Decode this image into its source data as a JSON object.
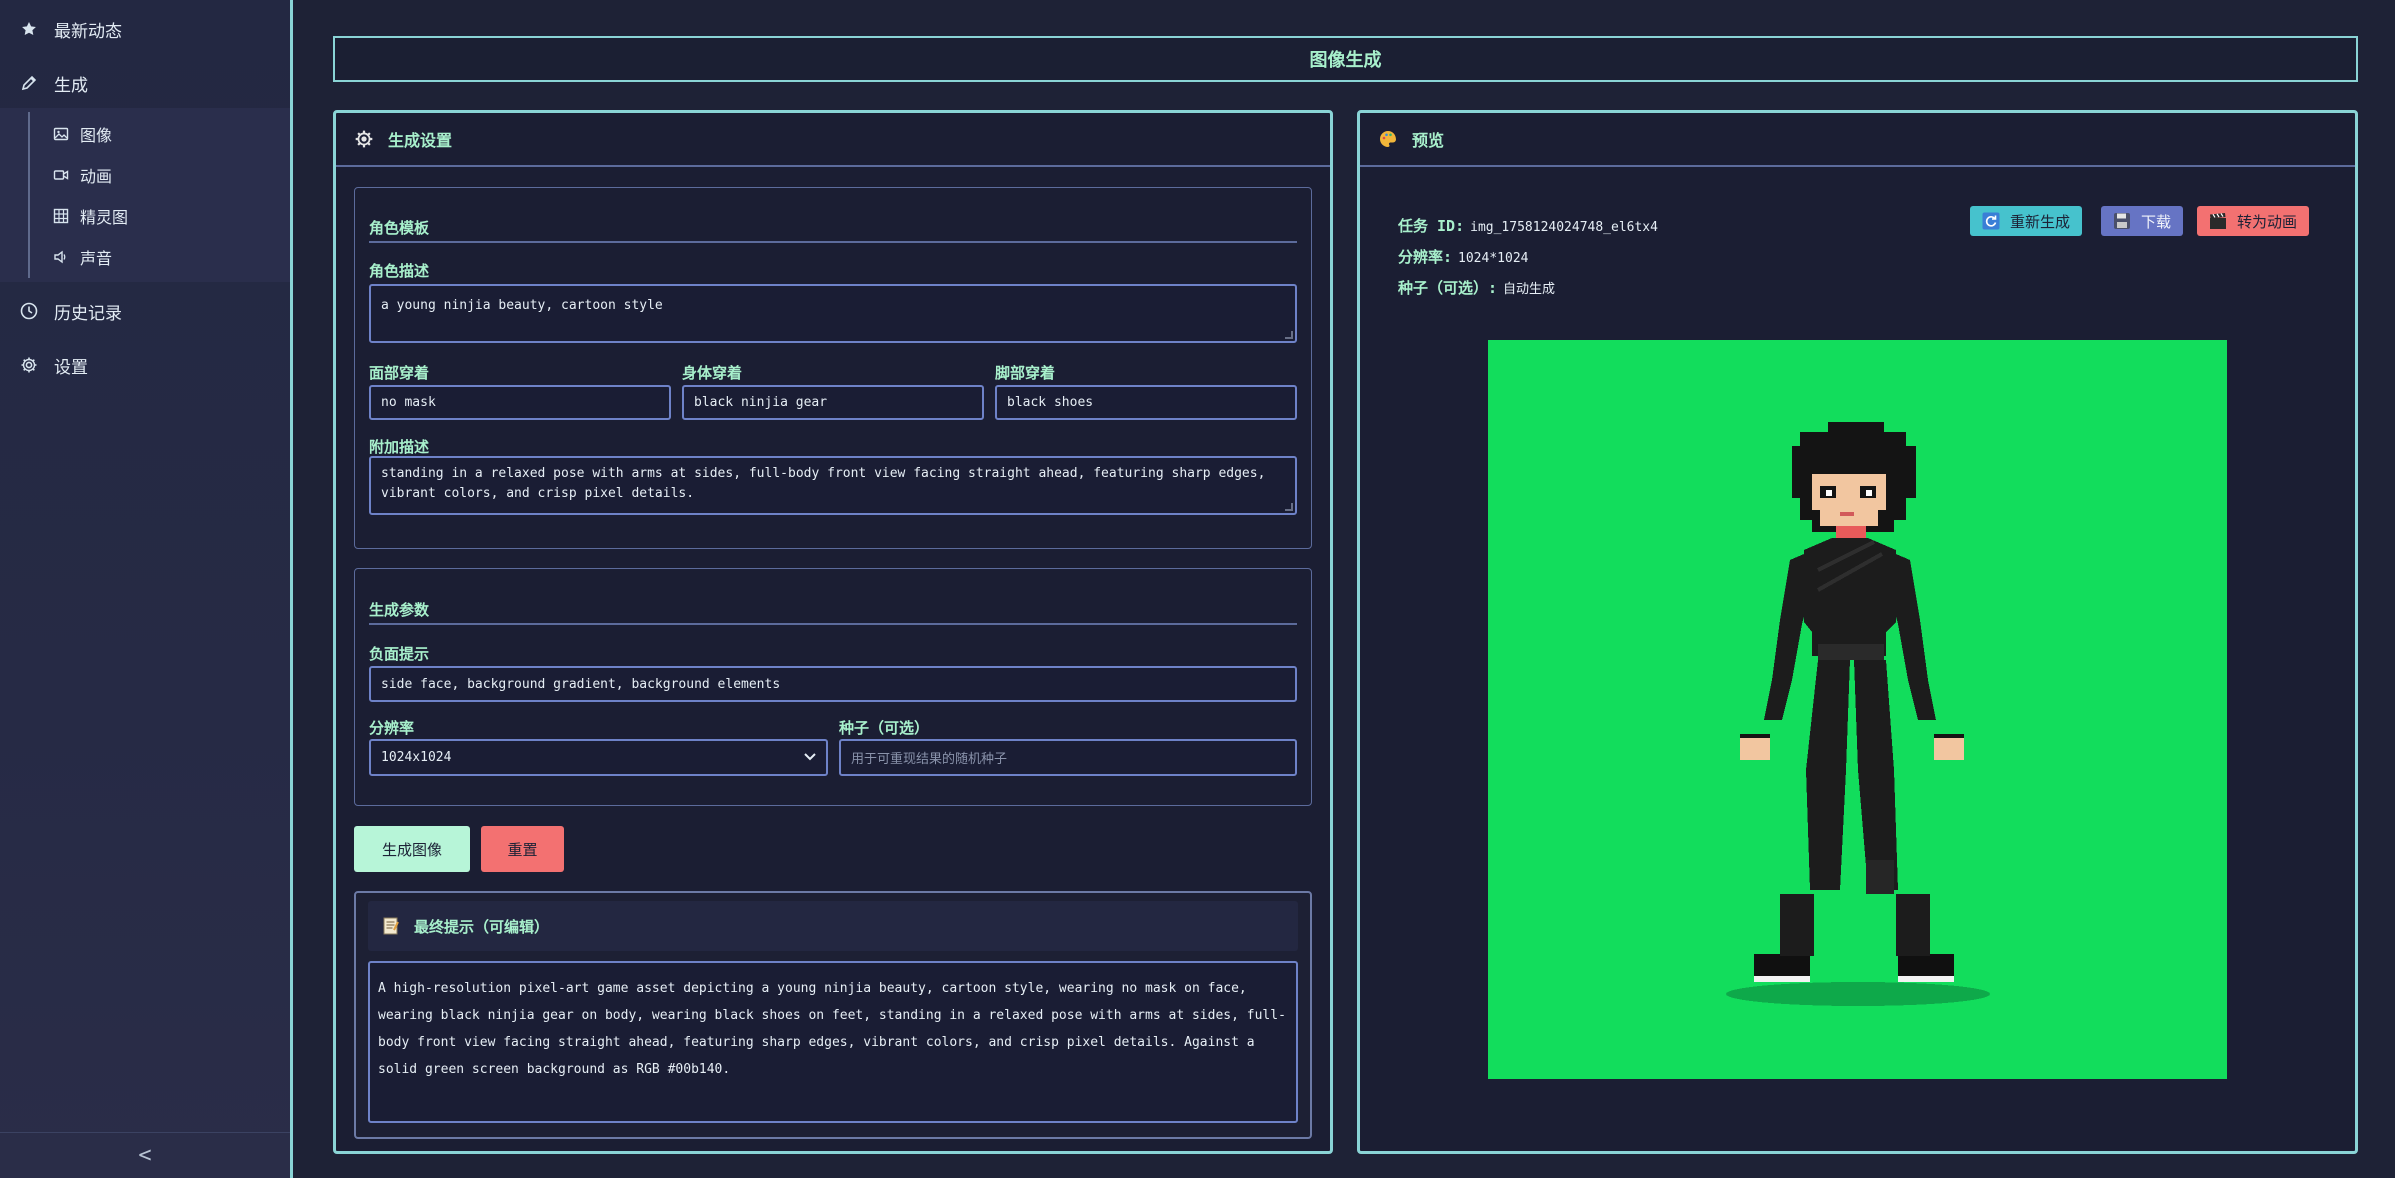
{
  "colors": {
    "accent": "#8ad4d6",
    "label": "#a8f0cc",
    "screen_green": "#00b140"
  },
  "sidebar": {
    "items": [
      {
        "label": "最新动态",
        "icon": "star-icon"
      },
      {
        "label": "生成",
        "icon": "pencil-icon"
      }
    ],
    "sub_items": [
      {
        "label": "图像",
        "icon": "image-icon"
      },
      {
        "label": "动画",
        "icon": "video-icon"
      },
      {
        "label": "精灵图",
        "icon": "grid-icon"
      },
      {
        "label": "声音",
        "icon": "speaker-icon"
      }
    ],
    "bottom_items": [
      {
        "label": "历史记录",
        "icon": "clock-icon"
      },
      {
        "label": "设置",
        "icon": "gear-icon"
      }
    ],
    "collapse_label": "<"
  },
  "page": {
    "title": "图像生成"
  },
  "settings": {
    "title": "生成设置",
    "template": {
      "title": "角色模板",
      "desc_label": "角色描述",
      "desc_value": "a young ninjia beauty, cartoon style",
      "face_label": "面部穿着",
      "face_value": "no mask",
      "body_label": "身体穿着",
      "body_value": "black ninjia gear",
      "feet_label": "脚部穿着",
      "feet_value": "black shoes",
      "extra_label": "附加描述",
      "extra_value": "standing in a relaxed pose with arms at sides, full-body front view facing straight ahead, featuring sharp edges, vibrant colors, and crisp pixel details."
    },
    "params": {
      "title": "生成参数",
      "neg_label": "负面提示",
      "neg_value": "side face, background gradient, background elements",
      "res_label": "分辨率",
      "res_value": "1024x1024",
      "seed_label": "种子（可选）",
      "seed_placeholder": "用于可重现结果的随机种子"
    },
    "generate_label": "生成图像",
    "reset_label": "重置",
    "final_prompt": {
      "title": "最终提示（可编辑）",
      "text": "A high-resolution pixel-art game asset depicting a young ninjia beauty, cartoon style, wearing no mask on face, wearing black ninjia gear on body, wearing black shoes on feet, standing in a relaxed pose with arms at sides, full-body front view facing straight ahead, featuring sharp edges, vibrant colors, and crisp pixel details. Against a solid green screen background as RGB #00b140."
    }
  },
  "preview": {
    "title": "预览",
    "task_label": "任务 ID:",
    "task_value": "img_1758124024748_el6tx4",
    "res_label": "分辨率:",
    "res_value": "1024*1024",
    "seed_label": "种子（可选）:",
    "seed_value": "自动生成",
    "regen_label": "重新生成",
    "download_label": "下载",
    "animate_label": "转为动画"
  }
}
